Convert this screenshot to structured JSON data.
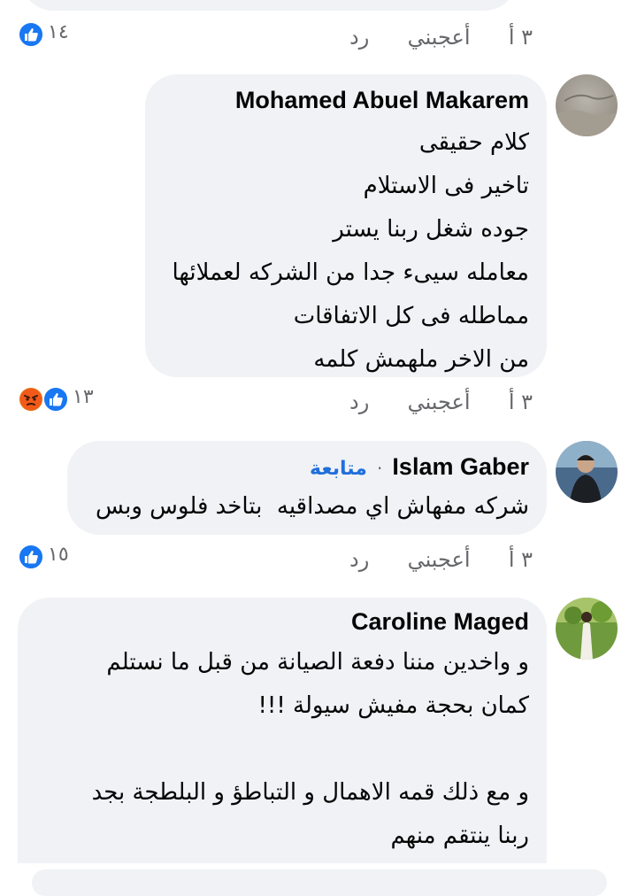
{
  "comment0": {
    "time": "٣ أ",
    "like": "أعجبني",
    "reply": "رد",
    "reaction_count": "١٤"
  },
  "comment1": {
    "author": "Mohamed Abuel Makarem",
    "lines": [
      "كلام حقيقى",
      "تاخير فى الاستلام",
      "جوده شغل ربنا يستر",
      "معامله سيىء جدا من الشركه لعملائها",
      "مماطله فى كل الاتفاقات",
      "من الاخر ملهمش كلمه"
    ],
    "time": "٣ أ",
    "like": "أعجبني",
    "reply": "رد",
    "reaction_count": "١٣"
  },
  "comment2": {
    "author": "Islam Gaber",
    "follow": "متابعة",
    "separator": "·",
    "lines": [
      "شركه مفهاش اي مصداقيه  بتاخد فلوس وبس"
    ],
    "time": "٣ أ",
    "like": "أعجبني",
    "reply": "رد",
    "reaction_count": "١٥"
  },
  "comment3": {
    "author": "Caroline Maged",
    "lines": [
      "و واخدين مننا دفعة الصيانة من قبل ما نستلم",
      "كمان بحجة مفيش سيولة !!!",
      "",
      "و مع ذلك قمه الاهمال و التباطؤ و البلطجة بجد",
      "ربنا ينتقم منهم"
    ]
  },
  "colors": {
    "bubble": "#f0f2f5",
    "like_blue": "#1877f2",
    "angry_orange": "#e9710f",
    "follow_blue": "#216fdb",
    "meta_gray": "#65676b"
  },
  "icons": [
    "like-icon",
    "angry-icon"
  ]
}
